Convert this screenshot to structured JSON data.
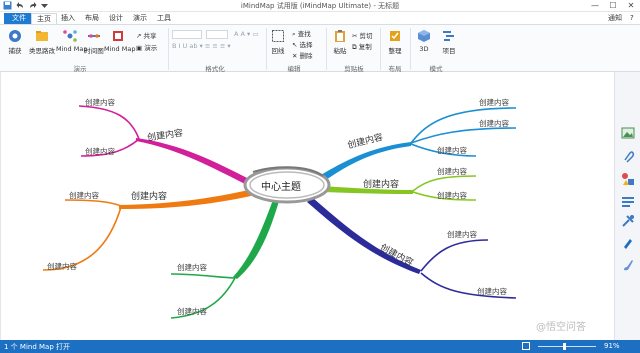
{
  "window": {
    "title": "iMindMap 试用版 (iMindMap Ultimate) - 无标题",
    "minimize": "—",
    "maximize": "☐",
    "close": "✕"
  },
  "menu": {
    "tabs": [
      "文件",
      "主页",
      "插入",
      "布局",
      "设计",
      "演示",
      "工具"
    ],
    "notifications": "通知",
    "help": "?"
  },
  "ribbon": {
    "buttons": {
      "capture": "捕获",
      "quick_entry": "类思路改",
      "mind_map": "Mind Map",
      "time_map": "时间图",
      "mind_map2": "Mind Map",
      "share": "共享",
      "present": "演示",
      "central_theme": "回线",
      "find": "查找",
      "select": "选择",
      "delete": "删除",
      "paste": "粘贴",
      "cut": "剪切",
      "copy": "复制",
      "tidy": "整理",
      "view_3d": "3D",
      "project": "项目"
    },
    "groups": {
      "demo": "演示",
      "format": "格式化",
      "edit": "编辑",
      "clipboard": "剪贴板",
      "layout": "布局",
      "mode": "模式"
    }
  },
  "map": {
    "center": "中心主题",
    "branches": [
      {
        "label": "创建内容",
        "color": "#d21f9a",
        "subs": [
          "创建内容",
          "创建内容"
        ]
      },
      {
        "label": "创建内容",
        "color": "#f07a12",
        "subs": [
          "创建内容",
          "创建内容"
        ]
      },
      {
        "label": "",
        "color": "#1fa84a",
        "subs": [
          "创建内容",
          "创建内容"
        ]
      },
      {
        "label": "创建内容",
        "color": "#1a8fd3",
        "subs": [
          "创建内容",
          "创建内容",
          "创建内容"
        ]
      },
      {
        "label": "创建内容",
        "color": "#86c623",
        "subs": [
          "创建内容",
          "创建内容"
        ]
      },
      {
        "label": "创建内容",
        "color": "#2b2c9a",
        "subs": [
          "创建内容",
          "创建内容"
        ]
      }
    ]
  },
  "rightbar_icons": [
    "image-icon",
    "attachment-icon",
    "shapes-icon",
    "notes-icon",
    "tools-icon",
    "pen-icon",
    "brush-icon"
  ],
  "status": {
    "left": "1 个 Mind Map 打开",
    "zoom": "91%"
  },
  "watermark": "@悟空问答"
}
